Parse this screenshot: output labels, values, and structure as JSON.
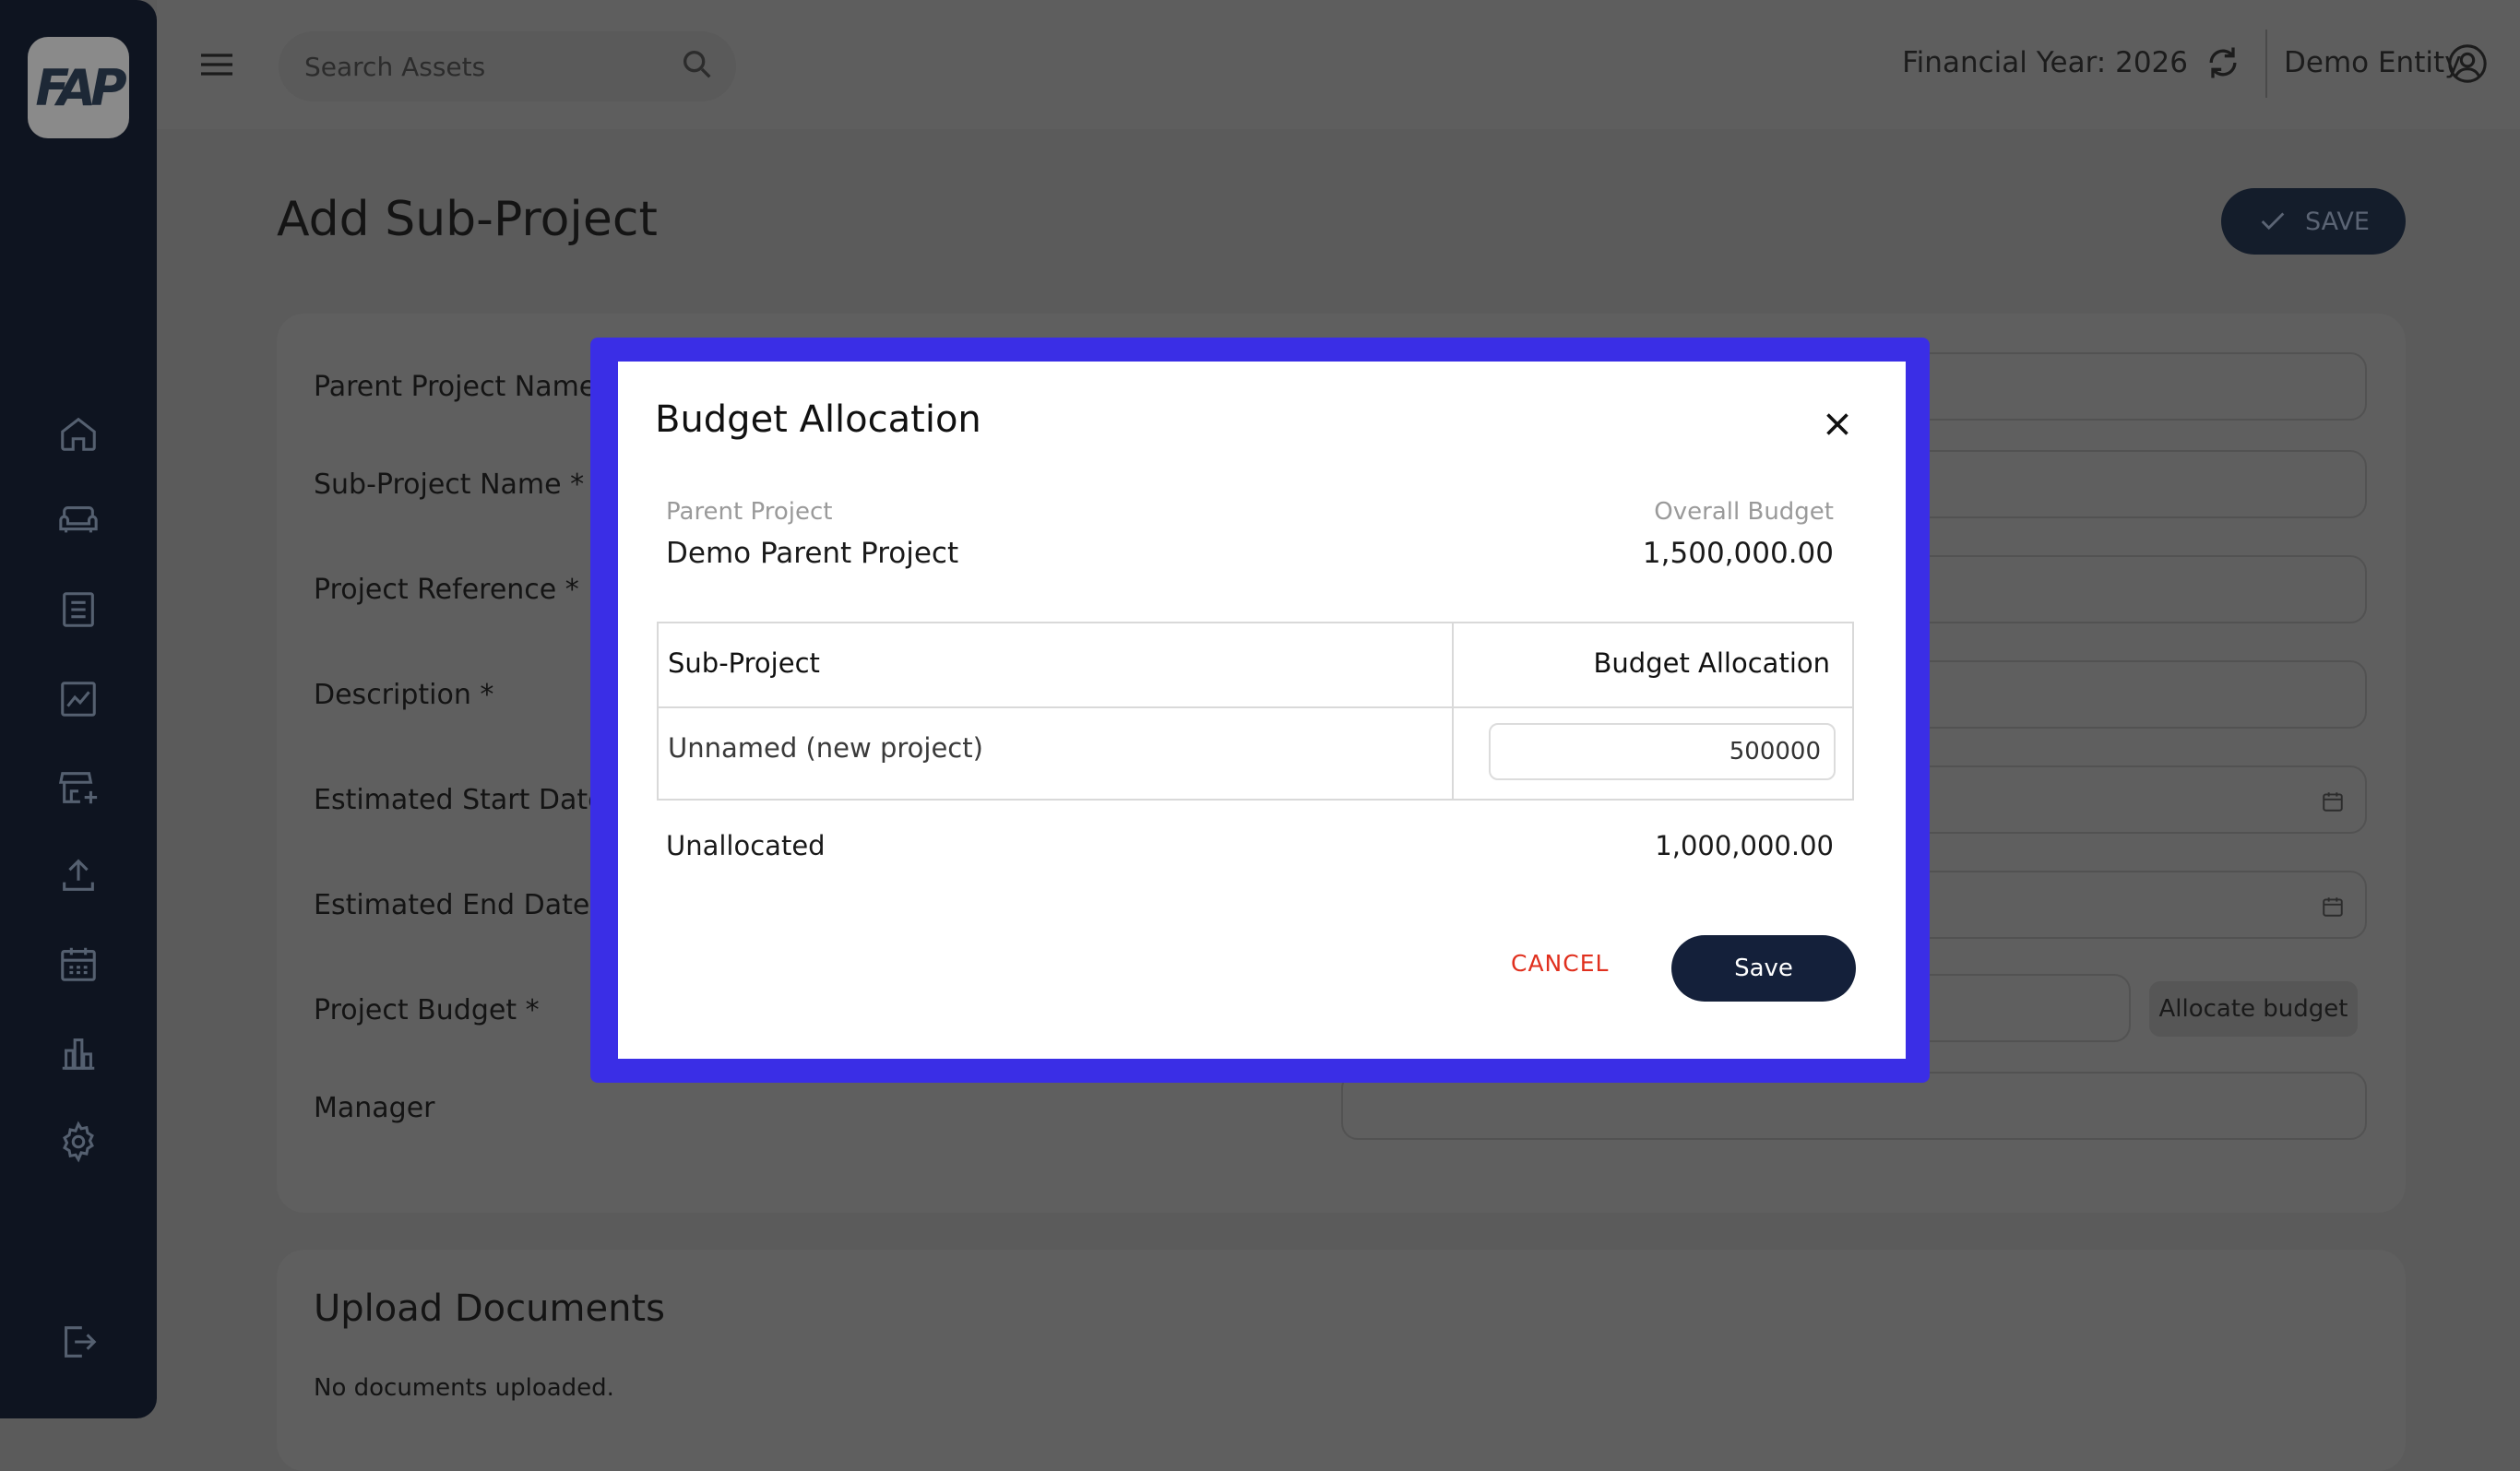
{
  "app": {
    "logo_text": "FAP"
  },
  "sidebar": {
    "items": [
      {
        "icon": "home-icon"
      },
      {
        "icon": "sofa-icon"
      },
      {
        "icon": "list-icon"
      },
      {
        "icon": "chart-icon"
      },
      {
        "icon": "store-add-icon"
      },
      {
        "icon": "upload-icon"
      },
      {
        "icon": "calendar-icon"
      },
      {
        "icon": "bar-chart-icon"
      },
      {
        "icon": "gear-icon"
      }
    ],
    "logout_icon": "logout-icon"
  },
  "topbar": {
    "search_placeholder": "Search Assets",
    "financial_year": "Financial Year: 2026",
    "entity": "Demo Entity"
  },
  "page": {
    "title": "Add Sub-Project",
    "save_label": "SAVE",
    "fields": [
      {
        "label": "Parent Project Name"
      },
      {
        "label": "Sub-Project Name *"
      },
      {
        "label": "Project Reference *"
      },
      {
        "label": "Description *"
      },
      {
        "label": "Estimated Start Date *"
      },
      {
        "label": "Estimated End Date *"
      },
      {
        "label": "Project Budget *"
      },
      {
        "label": "Manager"
      }
    ],
    "allocate_label": "Allocate budget",
    "upload_title": "Upload Documents",
    "upload_empty": "No documents uploaded."
  },
  "modal": {
    "title": "Budget Allocation",
    "parent_project_label": "Parent Project",
    "parent_project_value": "Demo Parent Project",
    "overall_budget_label": "Overall Budget",
    "overall_budget_value": "1,500,000.00",
    "table": {
      "col_subproject": "Sub-Project",
      "col_allocation": "Budget Allocation",
      "rows": [
        {
          "name": "Unnamed (new project)",
          "allocation": "500000"
        }
      ]
    },
    "unallocated_label": "Unallocated",
    "unallocated_value": "1,000,000.00",
    "cancel_label": "CANCEL",
    "save_label": "Save"
  }
}
